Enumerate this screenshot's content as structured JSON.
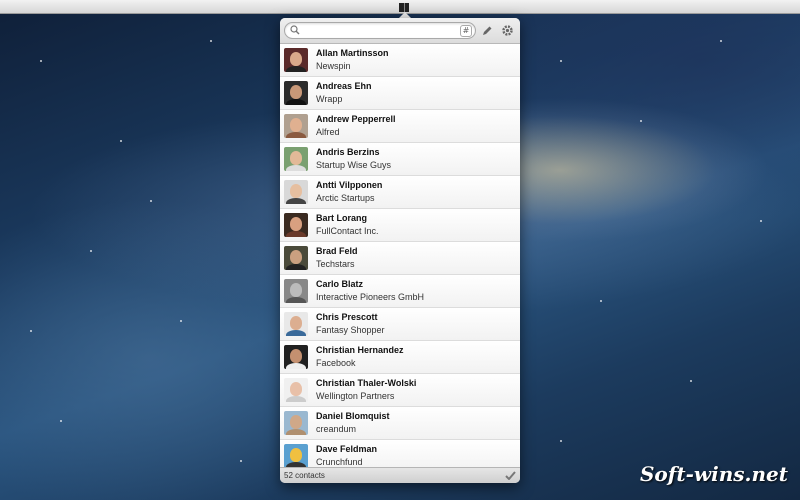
{
  "menubar": {
    "app_icon": "contacts-book-icon"
  },
  "search": {
    "placeholder": "",
    "value": "",
    "tag_button": "#"
  },
  "toolbar": {
    "edit_icon": "pencil-icon",
    "settings_icon": "gear-icon"
  },
  "contacts": [
    {
      "name": "Allan Martinsson",
      "company": "Newspin"
    },
    {
      "name": "Andreas Ehn",
      "company": "Wrapp"
    },
    {
      "name": "Andrew Pepperrell",
      "company": "Alfred"
    },
    {
      "name": "Andris Berzins",
      "company": "Startup Wise Guys"
    },
    {
      "name": "Antti Vilpponen",
      "company": "Arctic Startups"
    },
    {
      "name": "Bart Lorang",
      "company": "FullContact Inc."
    },
    {
      "name": "Brad Feld",
      "company": "Techstars"
    },
    {
      "name": "Carlo Blatz",
      "company": "Interactive Pioneers GmbH"
    },
    {
      "name": "Chris Prescott",
      "company": "Fantasy Shopper"
    },
    {
      "name": "Christian Hernandez",
      "company": "Facebook"
    },
    {
      "name": "Christian Thaler-Wolski",
      "company": "Wellington Partners"
    },
    {
      "name": "Daniel Blomquist",
      "company": "creandum"
    },
    {
      "name": "Dave Feldman",
      "company": "Crunchfund"
    }
  ],
  "footer": {
    "count_text": "52 contacts",
    "confirm_icon": "checkmark-icon"
  },
  "watermark": "Soft-wins.net"
}
